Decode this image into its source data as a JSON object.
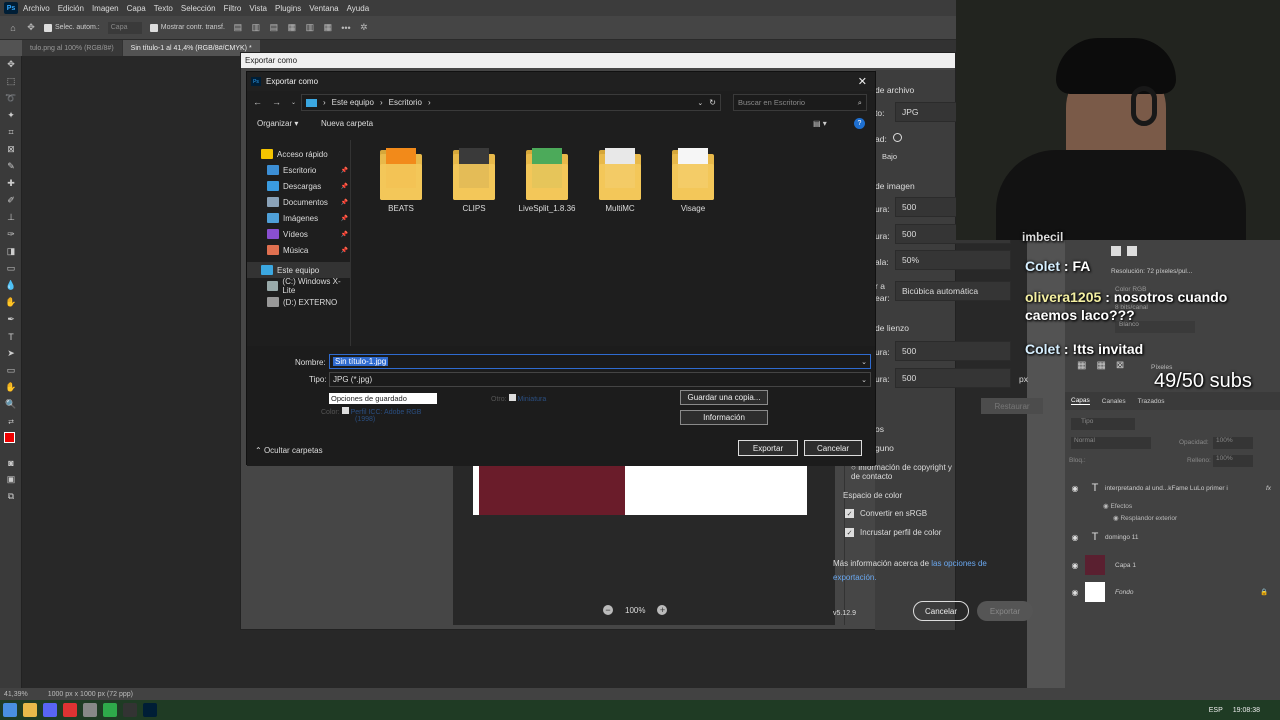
{
  "menubar": {
    "app_icon": "Ps",
    "items": [
      "Archivo",
      "Edición",
      "Imagen",
      "Capa",
      "Texto",
      "Selección",
      "Filtro",
      "Vista",
      "Plugins",
      "Ventana",
      "Ayuda"
    ]
  },
  "optionsbar": {
    "auto_select": "Selec. autom.:",
    "auto_select_value": "Capa",
    "show_transform": "Mostrar contr. transf."
  },
  "tabs": [
    {
      "label": "tulo.png al 100% (RGB/8#)"
    },
    {
      "label": "Sin título-1 al 41,4% (RGB/8#/CMYK) *"
    }
  ],
  "exportas": {
    "title": "Exportar como",
    "file_settings": "de archivo",
    "format_label": "to:",
    "format_value": "JPG",
    "quality_label": "ad:",
    "quality_value": "Bajo",
    "image_size": "de imagen",
    "width_label": "ura:",
    "width_value": "500",
    "height_label": "ura:",
    "height_value": "500",
    "scale_label": "ala:",
    "scale_value": "50%",
    "resample_label1": "r a",
    "resample_label2": "ear:",
    "resample_value": "Bicúbica automática",
    "canvas_size": "de lienzo",
    "canvas_width_label": "ura:",
    "canvas_width_value": "500",
    "canvas_height_label": "ura:",
    "canvas_height_value": "500",
    "px_unit": "px",
    "restore": "Restaurar",
    "metadata_label": "os",
    "metadata_none": "guno",
    "copyright": "Información de copyright y de contacto",
    "color_space": "Espacio de color",
    "srgb": "Convertir en sRGB",
    "embed_profile": "Incrustar perfil de color",
    "more_info": "Más información acerca de ",
    "more_info_link": "las opciones de",
    "more_info_link2": "exportación.",
    "zoom": "100%",
    "version": "v5.12.9",
    "cancel": "Cancelar",
    "export": "Exportar"
  },
  "file_dialog": {
    "icon": "Ps",
    "title": "Exportar como",
    "address": [
      "Este equipo",
      "Escritorio"
    ],
    "search_placeholder": "Buscar en Escritorio",
    "organize": "Organizar",
    "new_folder": "Nueva carpeta",
    "nav": [
      {
        "label": "Acceso rápido",
        "color": "#f5c400",
        "indent": false,
        "pin": false
      },
      {
        "label": "Escritorio",
        "color": "#3c8fd6",
        "indent": true,
        "pin": true
      },
      {
        "label": "Descargas",
        "color": "#3a9be0",
        "indent": true,
        "pin": true
      },
      {
        "label": "Documentos",
        "color": "#8aa2b8",
        "indent": true,
        "pin": true
      },
      {
        "label": "Imágenes",
        "color": "#4fa0d8",
        "indent": true,
        "pin": true
      },
      {
        "label": "Vídeos",
        "color": "#8a4fd0",
        "indent": true,
        "pin": true
      },
      {
        "label": "Música",
        "color": "#e07050",
        "indent": true,
        "pin": true
      },
      {
        "label": "Este equipo",
        "color": "#3ba7e0",
        "indent": false,
        "pin": false,
        "selected": true
      },
      {
        "label": "(C:) Windows X-Lite",
        "color": "#9aa",
        "indent": true,
        "pin": false
      },
      {
        "label": "(D:) EXTERNO",
        "color": "#999",
        "indent": true,
        "pin": false
      }
    ],
    "folders": [
      {
        "name": "BEATS",
        "paper": "#f28a1a"
      },
      {
        "name": "CLIPS",
        "paper": "#3a3a3a"
      },
      {
        "name": "LiveSplit_1.8.36",
        "paper": "#4caa5a"
      },
      {
        "name": "MultiMC",
        "paper": "#e8e8e8"
      },
      {
        "name": "Visage",
        "paper": "#f6f6f6"
      }
    ],
    "name_label": "Nombre:",
    "name_value": "Sin título-1.jpg",
    "type_label": "Tipo:",
    "type_value": "JPG (*.jpg)",
    "save_options": "Opciones de guardado",
    "color_label": "Color:",
    "color_value": "Perfil ICC: Adobe RGB",
    "color_value2": "(1998)",
    "other_label": "Otro:",
    "thumbnail": "Miniatura",
    "save_copy": "Guardar una copia...",
    "information": "Información",
    "hide_folders": "Ocultar carpetas",
    "export": "Exportar",
    "cancel": "Cancelar"
  },
  "layers_panel": {
    "resolution": "Resolución: 72 píxeles/pul...",
    "color_mode": "Color RGB",
    "bits": "8 bits/canal",
    "fill": "Blanco",
    "unit": "Píxeles",
    "tabs": [
      "Capas",
      "Canales",
      "Trazados"
    ],
    "search": "Tipo",
    "blend": "Normal",
    "opacity": "Opacidad:",
    "opacity_value": "100%",
    "lock": "Bloq.:",
    "fill_label": "Relleno:",
    "fill_value": "100%",
    "layers": [
      {
        "name": "interpretando al und...kFame LuLo primer i",
        "type": "text",
        "fx": "fx"
      },
      {
        "name": "Efectos",
        "type": "sub"
      },
      {
        "name": "Resplandor exterior",
        "type": "sub2"
      },
      {
        "name": "domingo 11",
        "type": "text"
      },
      {
        "name": "Capa 1",
        "type": "image"
      },
      {
        "name": "Fondo",
        "type": "bg"
      }
    ]
  },
  "status": {
    "zoom": "41,39%",
    "size": "1000 px x 1000 px (72 ppp)"
  },
  "taskbar": {
    "lang": "ESP",
    "time": "19:08:38"
  },
  "chat": [
    {
      "user": "",
      "text": "imbecil"
    },
    {
      "user": "Colet",
      "text": ": FA"
    },
    {
      "user": "olivera1205",
      "text": ": nosotros cuando caemos laco???"
    },
    {
      "user": "Colet",
      "text": ": !tts invitad"
    }
  ],
  "subs": "49/50 subs"
}
